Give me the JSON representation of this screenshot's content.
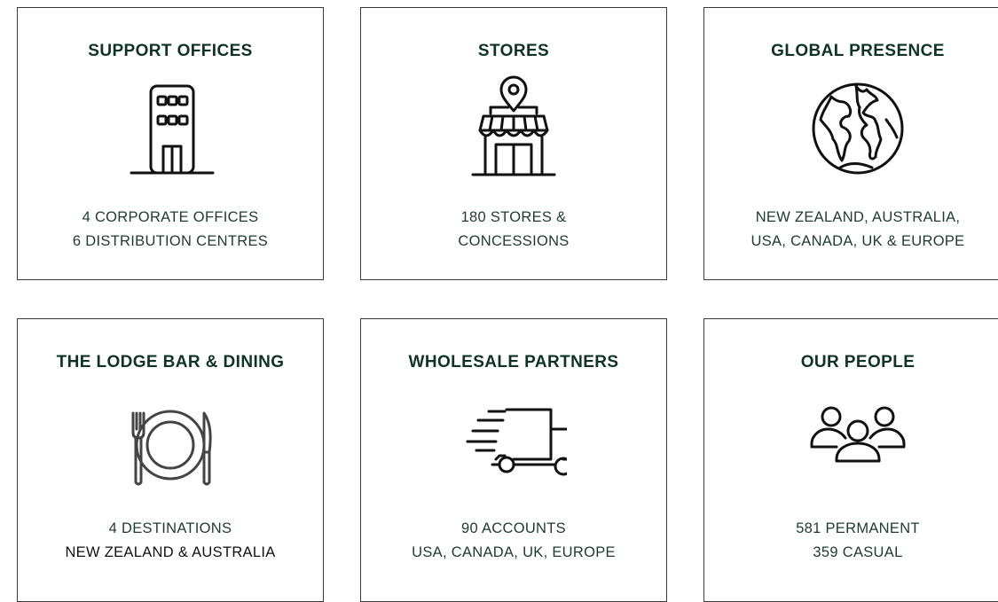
{
  "cards": [
    {
      "title": "SUPPORT OFFICES",
      "icon": "office-building-icon",
      "lines": [
        "4 CORPORATE OFFICES",
        "6 DISTRIBUTION CENTRES"
      ]
    },
    {
      "title": "STORES",
      "icon": "storefront-location-icon",
      "lines": [
        "180 STORES &",
        "CONCESSIONS"
      ]
    },
    {
      "title": "GLOBAL PRESENCE",
      "icon": "globe-icon",
      "lines": [
        "NEW ZEALAND, AUSTRALIA,",
        "USA, CANADA, UK & EUROPE"
      ]
    },
    {
      "title": "THE LODGE BAR & DINING",
      "icon": "dining-plate-icon",
      "lines": [
        "4 DESTINATIONS",
        "NEW ZEALAND & AUSTRALIA"
      ]
    },
    {
      "title": "WHOLESALE PARTNERS",
      "icon": "delivery-truck-icon",
      "lines": [
        "90 ACCOUNTS",
        "USA, CANADA, UK, EUROPE"
      ]
    },
    {
      "title": "OUR PEOPLE",
      "icon": "people-group-icon",
      "lines": [
        "581 PERMANENT",
        "359 CASUAL"
      ]
    }
  ],
  "colors": {
    "title": "#0f3324",
    "text": "#1f3b2e",
    "border": "#3a3a3a"
  }
}
